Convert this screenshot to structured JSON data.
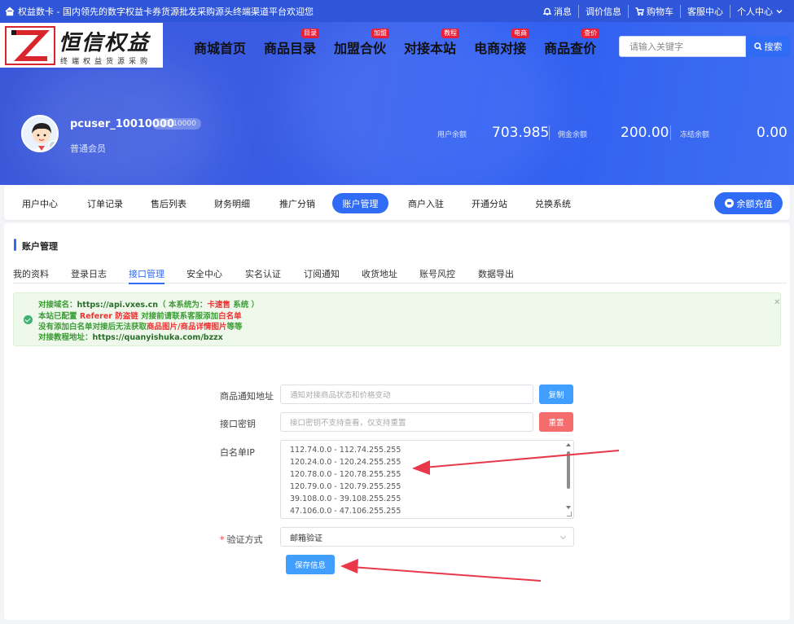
{
  "topbar": {
    "welcome": "权益数卡 - 国内领先的数字权益卡券货源批发采购源头终端渠道平台欢迎您",
    "items": [
      "消息",
      "调价信息",
      "购物车",
      "客服中心",
      "个人中心"
    ]
  },
  "logo": {
    "title": "恒信权益",
    "subtitle": "终端权益货源采购"
  },
  "nav": [
    {
      "label": "商城首页",
      "badge": ""
    },
    {
      "label": "商品目录",
      "badge": "目录"
    },
    {
      "label": "加盟合伙",
      "badge": "加盟"
    },
    {
      "label": "对接本站",
      "badge": "教程"
    },
    {
      "label": "电商对接",
      "badge": "电商"
    },
    {
      "label": "商品查价",
      "badge": "查价"
    }
  ],
  "search": {
    "placeholder": "请输入关键字",
    "button": "搜索"
  },
  "user": {
    "name": "pcuser_10010000",
    "uid": "UID:10000",
    "level": "普通会员"
  },
  "balances": [
    {
      "label": "用户余额",
      "value": "703.985"
    },
    {
      "label": "佣金余额",
      "value": "200.00"
    },
    {
      "label": "冻结余额",
      "value": "0.00"
    }
  ],
  "main_tabs": [
    "用户中心",
    "订单记录",
    "售后列表",
    "财务明细",
    "推广分销",
    "账户管理",
    "商户入驻",
    "开通分站",
    "兑换系统"
  ],
  "active_main_tab": "账户管理",
  "recharge_label": "余额充值",
  "section_title": "账户管理",
  "sub_tabs": [
    "我的资料",
    "登录日志",
    "接口管理",
    "安全中心",
    "实名认证",
    "订阅通知",
    "收货地址",
    "账号风控",
    "数据导出"
  ],
  "active_sub_tab": "接口管理",
  "alert": {
    "line1_a": "对接域名：",
    "line1_b": "https://api.vxes.cn",
    "line1_c": "（ 本系统为：",
    "line1_d": "卡速售",
    "line1_e": " 系统 ）",
    "line2_a": "本站已配置 ",
    "line2_b": "Referer 防盗链",
    "line2_c": " 对接前请联系客服添加",
    "line2_d": "白名单",
    "line3_a": "没有添加白名单对接后无法获取",
    "line3_b": "商品图片/商品详情图片",
    "line3_c": "等等",
    "line4_a": "对接教程地址：",
    "line4_b": "https://quanyishuka.com/bzzx"
  },
  "form": {
    "notify_label": "商品通知地址",
    "notify_placeholder": "通知对接商品状态和价格变动",
    "copy_button": "复制",
    "secret_label": "接口密钥",
    "secret_placeholder": "接口密钥不支持查看，仅支持重置",
    "reset_button": "重置",
    "whitelist_label": "白名单IP",
    "whitelist_ips": [
      "112.74.0.0 - 112.74.255.255",
      "120.24.0.0 - 120.24.255.255",
      "120.78.0.0 - 120.78.255.255",
      "120.79.0.0 - 120.79.255.255",
      "39.108.0.0 - 39.108.255.255",
      "47.106.0.0 - 47.106.255.255"
    ],
    "verify_required": "*",
    "verify_label": "验证方式",
    "verify_value": "邮箱验证",
    "save_button": "保存信息"
  },
  "colors": {
    "primary": "#2f6bf5",
    "topbar": "#2f56d9",
    "danger": "#f56c6c",
    "success": "#3b9b34",
    "annotation_arrow": "#e8394a"
  }
}
